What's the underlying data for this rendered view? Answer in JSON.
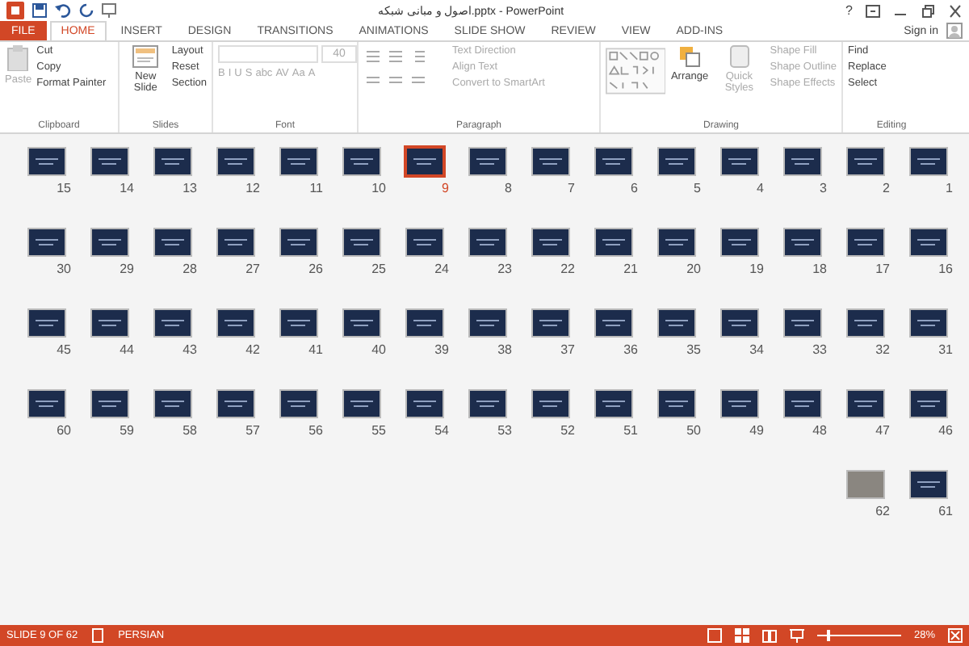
{
  "window": {
    "title": "اصول و مبانی شبکه.pptx - PowerPoint",
    "help": "?",
    "sign_in": "Sign in"
  },
  "tabs": [
    {
      "label": "FILE",
      "selected": false,
      "kind": "file"
    },
    {
      "label": "HOME",
      "selected": true,
      "kind": "tab"
    },
    {
      "label": "INSERT",
      "selected": false,
      "kind": "tab"
    },
    {
      "label": "DESIGN",
      "selected": false,
      "kind": "tab"
    },
    {
      "label": "TRANSITIONS",
      "selected": false,
      "kind": "tab"
    },
    {
      "label": "ANIMATIONS",
      "selected": false,
      "kind": "tab"
    },
    {
      "label": "SLIDE SHOW",
      "selected": false,
      "kind": "tab"
    },
    {
      "label": "REVIEW",
      "selected": false,
      "kind": "tab"
    },
    {
      "label": "VIEW",
      "selected": false,
      "kind": "tab"
    },
    {
      "label": "ADD-INS",
      "selected": false,
      "kind": "tab"
    }
  ],
  "ribbon": {
    "clipboard": {
      "label": "Clipboard",
      "paste": "Paste",
      "items": [
        "Cut",
        "Copy",
        "Format Painter"
      ]
    },
    "slides": {
      "label": "Slides",
      "new_slide": "New Slide",
      "items": [
        "Layout",
        "Reset",
        "Section"
      ]
    },
    "font": {
      "label": "Font",
      "size": "40",
      "buttons": [
        "B",
        "I",
        "U",
        "S",
        "abc",
        "AV",
        "Aa",
        "A"
      ]
    },
    "paragraph": {
      "label": "Paragraph",
      "items": [
        "Text Direction",
        "Align Text",
        "Convert to SmartArt"
      ]
    },
    "drawing": {
      "label": "Drawing",
      "arrange": "Arrange",
      "quick_styles": "Quick Styles",
      "items": [
        "Shape Fill",
        "Shape Outline",
        "Shape Effects"
      ]
    },
    "editing": {
      "label": "Editing",
      "items": [
        "Find",
        "Replace",
        "Select"
      ]
    }
  },
  "slides": [
    {
      "number": "15",
      "selected": false,
      "kind": "dark"
    },
    {
      "number": "14",
      "selected": false,
      "kind": "dark"
    },
    {
      "number": "13",
      "selected": false,
      "kind": "dark"
    },
    {
      "number": "12",
      "selected": false,
      "kind": "dark"
    },
    {
      "number": "11",
      "selected": false,
      "kind": "dark"
    },
    {
      "number": "10",
      "selected": false,
      "kind": "dark"
    },
    {
      "number": "9",
      "selected": true,
      "kind": "dark"
    },
    {
      "number": "8",
      "selected": false,
      "kind": "dark"
    },
    {
      "number": "7",
      "selected": false,
      "kind": "dark"
    },
    {
      "number": "6",
      "selected": false,
      "kind": "dark"
    },
    {
      "number": "5",
      "selected": false,
      "kind": "dark"
    },
    {
      "number": "4",
      "selected": false,
      "kind": "dark"
    },
    {
      "number": "3",
      "selected": false,
      "kind": "dark"
    },
    {
      "number": "2",
      "selected": false,
      "kind": "dark"
    },
    {
      "number": "1",
      "selected": false,
      "kind": "dark"
    },
    {
      "number": "30",
      "selected": false,
      "kind": "dark"
    },
    {
      "number": "29",
      "selected": false,
      "kind": "dark"
    },
    {
      "number": "28",
      "selected": false,
      "kind": "dark"
    },
    {
      "number": "27",
      "selected": false,
      "kind": "dark"
    },
    {
      "number": "26",
      "selected": false,
      "kind": "dark"
    },
    {
      "number": "25",
      "selected": false,
      "kind": "dark"
    },
    {
      "number": "24",
      "selected": false,
      "kind": "dark"
    },
    {
      "number": "23",
      "selected": false,
      "kind": "dark"
    },
    {
      "number": "22",
      "selected": false,
      "kind": "dark"
    },
    {
      "number": "21",
      "selected": false,
      "kind": "dark"
    },
    {
      "number": "20",
      "selected": false,
      "kind": "dark"
    },
    {
      "number": "19",
      "selected": false,
      "kind": "dark"
    },
    {
      "number": "18",
      "selected": false,
      "kind": "dark"
    },
    {
      "number": "17",
      "selected": false,
      "kind": "dark"
    },
    {
      "number": "16",
      "selected": false,
      "kind": "dark"
    },
    {
      "number": "45",
      "selected": false,
      "kind": "dark"
    },
    {
      "number": "44",
      "selected": false,
      "kind": "dark"
    },
    {
      "number": "43",
      "selected": false,
      "kind": "dark"
    },
    {
      "number": "42",
      "selected": false,
      "kind": "dark"
    },
    {
      "number": "41",
      "selected": false,
      "kind": "dark"
    },
    {
      "number": "40",
      "selected": false,
      "kind": "dark"
    },
    {
      "number": "39",
      "selected": false,
      "kind": "dark"
    },
    {
      "number": "38",
      "selected": false,
      "kind": "dark"
    },
    {
      "number": "37",
      "selected": false,
      "kind": "dark"
    },
    {
      "number": "36",
      "selected": false,
      "kind": "dark"
    },
    {
      "number": "35",
      "selected": false,
      "kind": "dark"
    },
    {
      "number": "34",
      "selected": false,
      "kind": "dark"
    },
    {
      "number": "33",
      "selected": false,
      "kind": "dark"
    },
    {
      "number": "32",
      "selected": false,
      "kind": "dark"
    },
    {
      "number": "31",
      "selected": false,
      "kind": "dark"
    },
    {
      "number": "60",
      "selected": false,
      "kind": "dark"
    },
    {
      "number": "59",
      "selected": false,
      "kind": "dark"
    },
    {
      "number": "58",
      "selected": false,
      "kind": "dark"
    },
    {
      "number": "57",
      "selected": false,
      "kind": "dark"
    },
    {
      "number": "56",
      "selected": false,
      "kind": "dark"
    },
    {
      "number": "55",
      "selected": false,
      "kind": "dark"
    },
    {
      "number": "54",
      "selected": false,
      "kind": "dark"
    },
    {
      "number": "53",
      "selected": false,
      "kind": "dark"
    },
    {
      "number": "52",
      "selected": false,
      "kind": "dark"
    },
    {
      "number": "51",
      "selected": false,
      "kind": "dark"
    },
    {
      "number": "50",
      "selected": false,
      "kind": "dark"
    },
    {
      "number": "49",
      "selected": false,
      "kind": "dark"
    },
    {
      "number": "48",
      "selected": false,
      "kind": "dark"
    },
    {
      "number": "47",
      "selected": false,
      "kind": "dark"
    },
    {
      "number": "46",
      "selected": false,
      "kind": "dark"
    },
    {
      "number": "62",
      "selected": false,
      "kind": "photo"
    },
    {
      "number": "61",
      "selected": false,
      "kind": "dark"
    }
  ],
  "status_bar": {
    "slide": "SLIDE 9 OF 62",
    "language": "PERSIAN",
    "zoom": "28%",
    "zoom_slider": {
      "level": 0.12
    }
  }
}
